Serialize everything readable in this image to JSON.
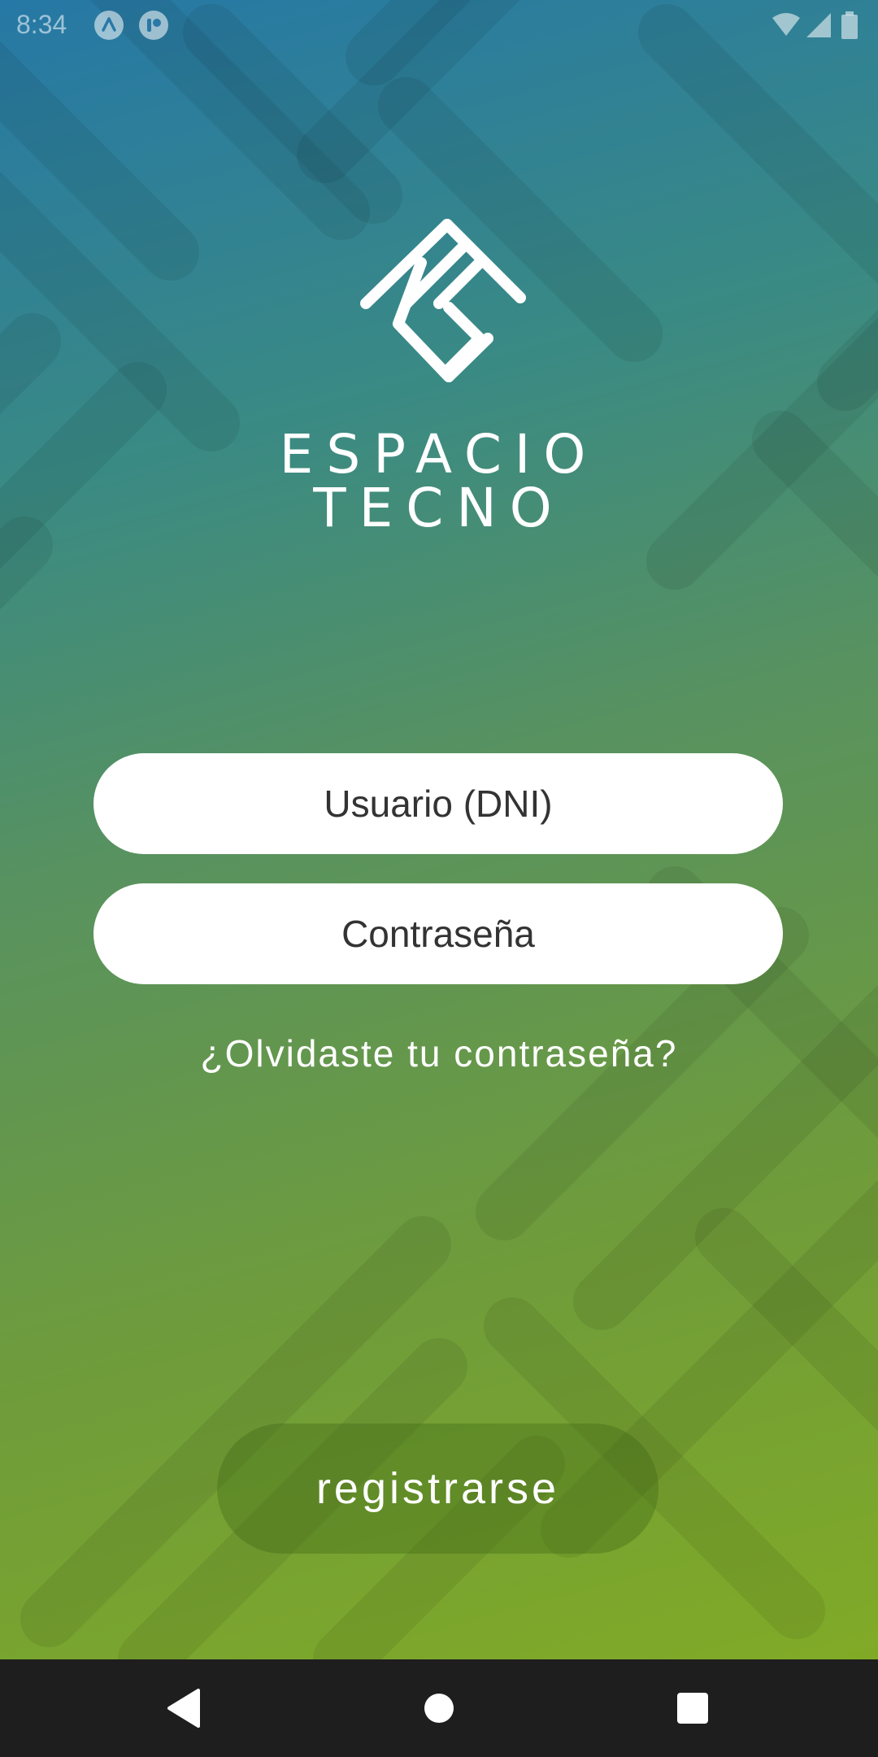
{
  "status_bar": {
    "time": "8:34",
    "icons": [
      "app-notification-icon-a",
      "app-notification-icon-b",
      "wifi-icon",
      "signal-icon",
      "battery-icon"
    ]
  },
  "brand": {
    "line1": "ESPACIO",
    "line2": "TECNO",
    "logo_icon": "espacio-tecno-logo"
  },
  "form": {
    "username_placeholder": "Usuario (DNI)",
    "username_value": "",
    "password_placeholder": "Contraseña",
    "password_value": ""
  },
  "forgot_password_label": "¿Olvidaste tu contraseña?",
  "register_label": "registrarse",
  "nav_bar": {
    "icons": [
      "back-icon",
      "home-icon",
      "recents-icon"
    ]
  },
  "colors": {
    "gradient_top": "#2678a6",
    "gradient_bottom": "#84ad22",
    "field_background": "#ffffff",
    "nav_background": "#1e1e1e"
  }
}
